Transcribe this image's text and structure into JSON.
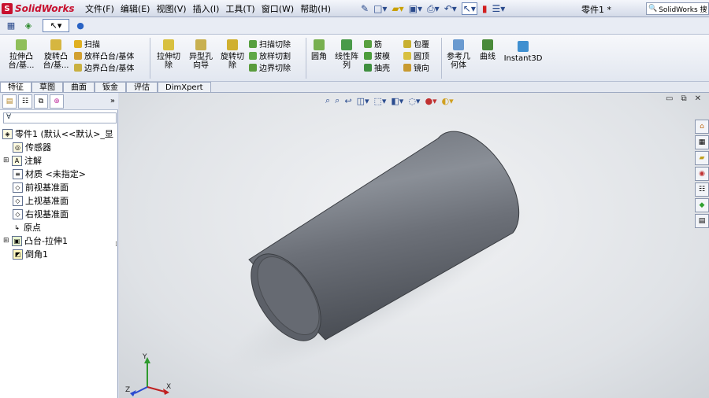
{
  "app": {
    "brand": "SolidWorks",
    "logo_mark": "S",
    "document_title": "零件1 *",
    "search_placeholder": "SolidWorks 搜"
  },
  "menus": [
    "文件(F)",
    "编辑(E)",
    "视图(V)",
    "插入(I)",
    "工具(T)",
    "窗口(W)",
    "帮助(H)"
  ],
  "quick_tools": [
    {
      "icon": "pin-icon",
      "glyph": "✎"
    },
    {
      "icon": "new-document-icon",
      "glyph": "□▾"
    },
    {
      "icon": "open-folder-icon",
      "glyph": "▰▾"
    },
    {
      "icon": "save-icon",
      "glyph": "▣▾"
    },
    {
      "icon": "print-icon",
      "glyph": "⎙▾"
    },
    {
      "icon": "undo-icon",
      "glyph": "↶▾"
    },
    {
      "icon": "select-icon",
      "glyph": "↖▾"
    },
    {
      "icon": "rebuild-icon",
      "glyph": "▮"
    },
    {
      "icon": "options-icon",
      "glyph": "☰▾"
    }
  ],
  "row2_tools": [
    {
      "icon": "sketch-icon",
      "glyph": "▦"
    },
    {
      "icon": "smart-dimension-icon",
      "glyph": "◈"
    },
    {
      "icon": "select-arrow-icon",
      "glyph": "↖▾"
    },
    {
      "icon": "appearance-icon",
      "glyph": "●"
    }
  ],
  "commands": {
    "extrude_boss": "拉伸凸\n台/基...",
    "revolve_boss": "旋转凸\n台/基...",
    "sweep": "扫描",
    "loft": "放样凸台/基体",
    "boundary_boss": "边界凸台/基体",
    "extrude_cut": "拉伸切\n除",
    "hole_wizard": "异型孔\n向导",
    "revolve_cut": "旋转切\n除",
    "sweep_cut": "扫描切除",
    "loft_cut": "放样切割",
    "boundary_cut": "边界切除",
    "fillet": "圆角",
    "linear_pattern": "线性阵\n列",
    "rib": "筋",
    "draft": "拔模",
    "shell": "抽壳",
    "wrap": "包覆",
    "intersect": "圆顶",
    "mirror": "镜向",
    "reference_geometry": "参考几\n何体",
    "curves": "曲线",
    "instant3d": "Instant3D"
  },
  "tabs": [
    {
      "label": "特征",
      "selected": true
    },
    {
      "label": "草图",
      "selected": false
    },
    {
      "label": "曲面",
      "selected": false
    },
    {
      "label": "钣金",
      "selected": false
    },
    {
      "label": "评估",
      "selected": false
    },
    {
      "label": "DimXpert",
      "selected": false
    }
  ],
  "feature_tree": {
    "filter_glyph": "∀",
    "items": [
      {
        "label": "零件1 (默认<<默认>_显",
        "icon": "part-icon",
        "expand": ""
      },
      {
        "label": "传感器",
        "icon": "sensor-icon",
        "expand": ""
      },
      {
        "label": "注解",
        "icon": "annotation-icon",
        "expand": "⊞"
      },
      {
        "label": "材质 <未指定>",
        "icon": "material-icon",
        "expand": ""
      },
      {
        "label": "前视基准面",
        "icon": "plane-icon",
        "expand": ""
      },
      {
        "label": "上视基准面",
        "icon": "plane-icon",
        "expand": ""
      },
      {
        "label": "右视基准面",
        "icon": "plane-icon",
        "expand": ""
      },
      {
        "label": "原点",
        "icon": "origin-icon",
        "expand": ""
      },
      {
        "label": "凸台-拉伸1",
        "icon": "extrude-feature-icon",
        "expand": "⊞"
      },
      {
        "label": "倒角1",
        "icon": "chamfer-feature-icon",
        "expand": ""
      }
    ]
  },
  "view": {
    "window_controls": [
      "▭",
      "⧉",
      "✕"
    ],
    "triad": {
      "x": "X",
      "y": "Y",
      "z": "Z"
    }
  },
  "colors": {
    "brand_red": "#c8102e",
    "cylinder_body": "#6f747c",
    "cylinder_face": "#5c6068"
  }
}
